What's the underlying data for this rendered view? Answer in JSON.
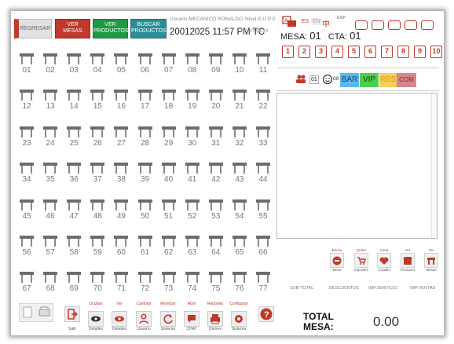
{
  "header": {
    "back_label": "REGRESAR",
    "view_tables": [
      "VER",
      "MESAS"
    ],
    "view_products": [
      "VER",
      "PRODUCTOS"
    ],
    "search_products": [
      "BUSCAR",
      "PRODUCTOS"
    ],
    "user_text": "Usuario:MECANICO RONALDO",
    "level_text": "Nivel:S U P E",
    "datetime": "20012025 11:57 PM TC",
    "tx_text": "TX 0000039"
  },
  "tables": [
    "01",
    "02",
    "03",
    "04",
    "05",
    "06",
    "07",
    "08",
    "09",
    "10",
    "11",
    "12",
    "13",
    "14",
    "15",
    "16",
    "17",
    "18",
    "19",
    "20",
    "21",
    "22",
    "23",
    "24",
    "25",
    "26",
    "27",
    "28",
    "29",
    "30",
    "31",
    "32",
    "33",
    "34",
    "35",
    "36",
    "37",
    "38",
    "39",
    "40",
    "41",
    "42",
    "43",
    "44",
    "45",
    "46",
    "47",
    "48",
    "49",
    "50",
    "51",
    "52",
    "53",
    "54",
    "55",
    "56",
    "57",
    "58",
    "59",
    "60",
    "61",
    "62",
    "63",
    "64",
    "65",
    "66",
    "67",
    "68",
    "69",
    "70",
    "71",
    "72",
    "73",
    "74",
    "75",
    "76",
    "77"
  ],
  "bottom_toolbar": [
    {
      "top": "",
      "cap": "Salir"
    },
    {
      "top": "Ocultan",
      "cap": "Detalles"
    },
    {
      "top": "Ver",
      "cap": "Detalles"
    },
    {
      "top": "Cambiar",
      "cap": "Usuario"
    },
    {
      "top": "Reiniciar",
      "cap": "Sistema"
    },
    {
      "top": "Abrir",
      "cap": "CHAT"
    },
    {
      "top": "Reportes",
      "cap": "Cierres"
    },
    {
      "top": "Configurar",
      "cap": "Sistema"
    },
    {
      "top": "",
      "cap": ""
    }
  ],
  "lang": {
    "es": "ES",
    "en": "EN",
    "zh": "中",
    "esp": "ESP"
  },
  "mesa": {
    "mesa_label": "MESA:",
    "mesa_value": "01",
    "cta_label": "CTA:",
    "cta_value": "01"
  },
  "seats": [
    "1",
    "2",
    "3",
    "4",
    "5",
    "6",
    "7",
    "8",
    "9",
    "10"
  ],
  "filters": {
    "count": "01",
    "zero": "00",
    "bar": "BAR",
    "vip": "VIP",
    "res": "RES",
    "com": "COM"
  },
  "actions": [
    {
      "top": "Borrar",
      "cap": "Mesa"
    },
    {
      "top": "Quitar",
      "cap": "Imp.Serv"
    },
    {
      "top": "Crear",
      "cap": "Cortella"
    },
    {
      "top": "Ver",
      "cap": "Producto"
    },
    {
      "top": "Ver",
      "cap": "Mesas"
    }
  ],
  "summary": {
    "subtotal": "SUB-TOTAL",
    "discounts": "DESCUENTOS",
    "service": "IMP.SERVICIO",
    "sales_tax": "IMP.VENTAS",
    "total_label_1": "TOTAL",
    "total_label_2": "MESA:",
    "total_value": "0.00"
  },
  "colors": {
    "accent": "#c0392b",
    "green": "#1e9a45",
    "teal": "#2a8f95"
  }
}
